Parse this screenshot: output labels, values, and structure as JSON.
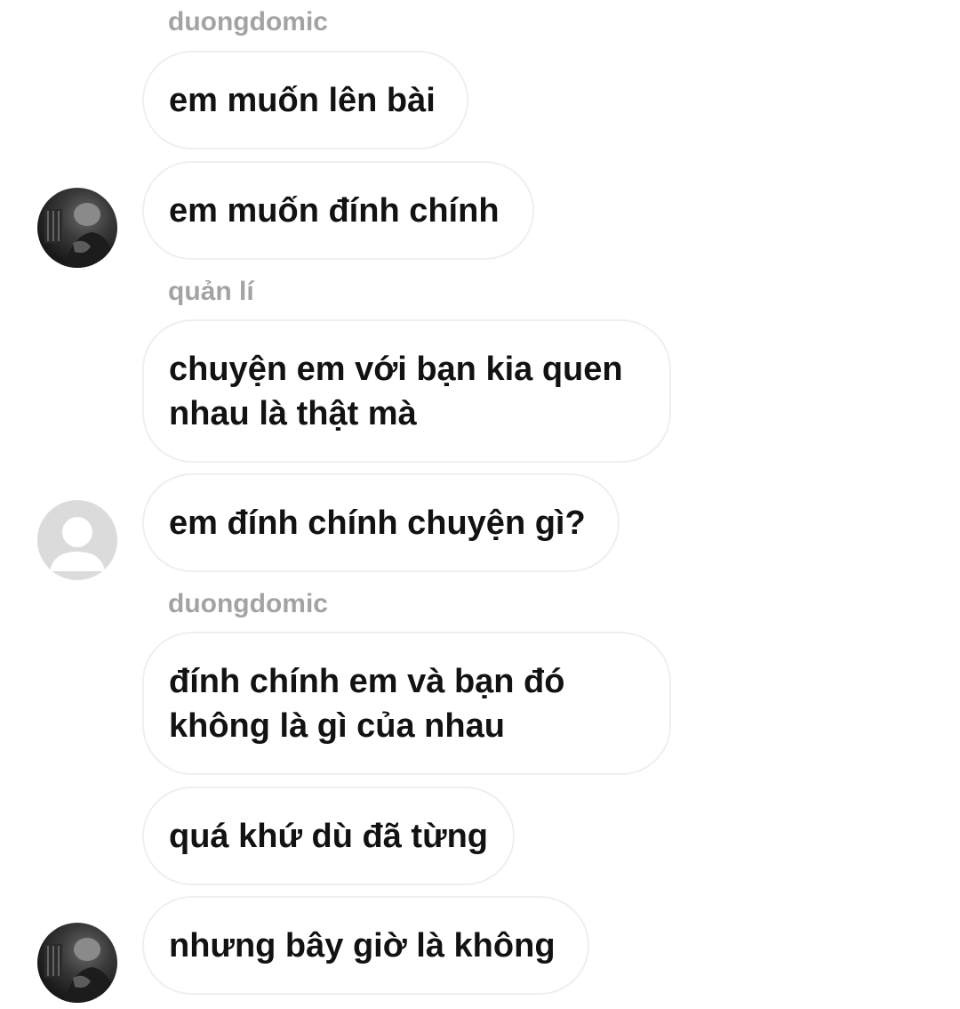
{
  "conversation": {
    "senders": [
      "duongdomic",
      "quản lí",
      "duongdomic"
    ],
    "messages": [
      "em muốn lên bài",
      "em muốn đính chính",
      "chuyện em với bạn kia quen\nnhau là thật mà",
      "em đính chính chuyện gì?",
      "đính chính em và bạn đó\nkhông là gì của nhau",
      "quá khứ dù đã từng",
      "nhưng bây giờ là không"
    ]
  },
  "colors": {
    "sender_name": "#a3a3a3",
    "message_text": "#121212",
    "bubble_border": "#efefef",
    "default_avatar": "#dbdbdb"
  },
  "icons": {
    "user_avatar": "user-photo-avatar-icon",
    "manager_avatar": "default-person-avatar-icon"
  }
}
